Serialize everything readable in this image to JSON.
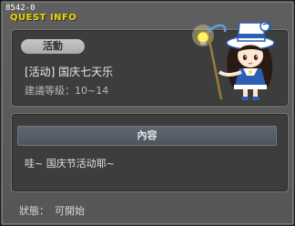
{
  "window": {
    "quest_id": "8542-0",
    "title": "QUEST INFO"
  },
  "quest": {
    "tag_label": "活動",
    "name": "[活动] 国庆七天乐",
    "level_label": "建議等級：",
    "level_value": "10~14"
  },
  "content": {
    "header": "內容",
    "text": "哇~ 国庆节活动耶~"
  },
  "status": {
    "label": "狀態：",
    "value": "可開始"
  },
  "colors": {
    "title": "#f2d200",
    "panel": "#3d3d3d",
    "window": "#5c5c5c"
  },
  "icons": {
    "npc": "npc-girl-with-lantern-staff-icon"
  }
}
